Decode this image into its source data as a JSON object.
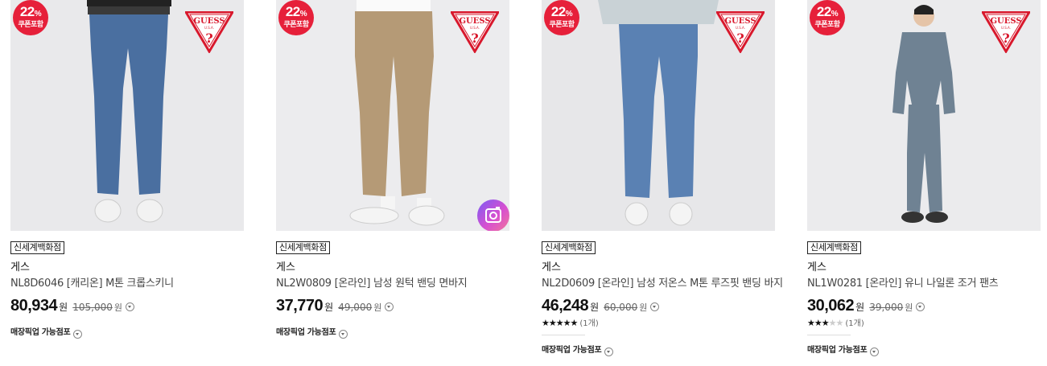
{
  "products": [
    {
      "discount": "22",
      "discount_unit": "%",
      "coupon_label": "쿠폰포함",
      "logo_text": "GUESS",
      "store_label": "신세계백화점",
      "brand": "게스",
      "name": "NL8D6046 [캐리온] M톤 크롭스키니",
      "price": "80,934",
      "price_unit": "원",
      "original_price": "105,000",
      "original_unit": "원",
      "pickup_label": "매장픽업 가능점포",
      "pant_color": "#4a6fa0"
    },
    {
      "discount": "22",
      "discount_unit": "%",
      "coupon_label": "쿠폰포함",
      "logo_text": "GUESS",
      "store_label": "신세계백화점",
      "brand": "게스",
      "name": "NL2W0809 [온라인] 남성 원턱 밴딩 면바지",
      "price": "37,770",
      "price_unit": "원",
      "original_price": "49,000",
      "original_unit": "원",
      "pickup_label": "매장픽업 가능점포",
      "pant_color": "#b59a76",
      "review_icon": "camera-icon"
    },
    {
      "discount": "22",
      "discount_unit": "%",
      "coupon_label": "쿠폰포함",
      "logo_text": "GUESS",
      "store_label": "신세계백화점",
      "brand": "게스",
      "name": "NL2D0609 [온라인] 남성 저온스 M톤 루즈핏 밴딩 바지",
      "price": "46,248",
      "price_unit": "원",
      "original_price": "60,000",
      "original_unit": "원",
      "rating_stars": 5,
      "rating_count": "(1개)",
      "pickup_label": "매장픽업 가능점포",
      "pant_color": "#5a81b3"
    },
    {
      "discount": "22",
      "discount_unit": "%",
      "coupon_label": "쿠폰포함",
      "logo_text": "GUESS",
      "store_label": "신세계백화점",
      "brand": "게스",
      "name": "NL1W0281 [온라인] 유니 나일론 조거 팬츠",
      "price": "30,062",
      "price_unit": "원",
      "original_price": "39,000",
      "original_unit": "원",
      "rating_stars": 3,
      "rating_count": "(1개)",
      "pickup_label": "매장픽업 가능점포",
      "pant_color": "#6f8293"
    }
  ]
}
